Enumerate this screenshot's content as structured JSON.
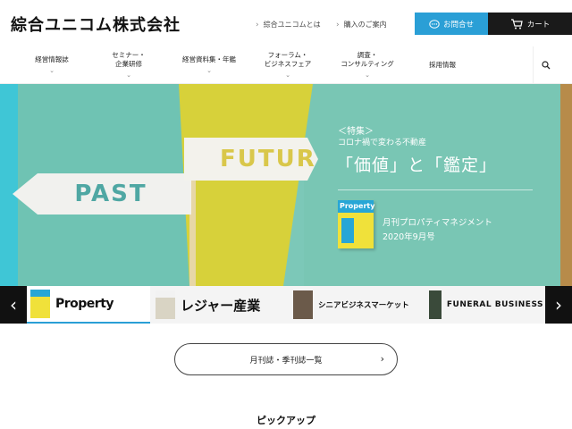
{
  "header": {
    "logo": "綜合ユニコム株式会社",
    "links": [
      {
        "label": "綜合ユニコムとは"
      },
      {
        "label": "購入のご案内"
      }
    ],
    "contact_label": "お問合せ",
    "cart_label": "カート"
  },
  "nav": {
    "items": [
      {
        "line1": "経営情報誌",
        "line2": ""
      },
      {
        "line1": "セミナー・",
        "line2": "企業研修"
      },
      {
        "line1": "経営資料集・年鑑",
        "line2": ""
      },
      {
        "line1": "フォーラム・",
        "line2": "ビジネスフェア"
      },
      {
        "line1": "調査・",
        "line2": "コンサルティング"
      },
      {
        "line1": "採用情報",
        "line2": ""
      }
    ]
  },
  "hero": {
    "past_word": "PAST",
    "future_word": "FUTUR",
    "tag": "＜特集＞",
    "subtitle": "コロナ禍で変わる不動産",
    "title": "「価値」と「鑑定」",
    "magazine_cover_text": "Property",
    "magazine_name": "月刊プロパティマネジメント",
    "issue": "2020年9月号"
  },
  "carousel": {
    "slides": [
      {
        "label": "Property"
      },
      {
        "label": "レジャー産業"
      },
      {
        "label": "シニアビジネスマーケット"
      },
      {
        "label": "FUNERAL BUSINESS"
      }
    ]
  },
  "list_button": {
    "label": "月刊誌・季刊誌一覧"
  },
  "section": {
    "pickup_title": "ピックアップ"
  },
  "colors": {
    "accent": "#2a9fd6",
    "cart": "#1a1a1a",
    "hero_teal": "#79c6b4",
    "hero_yellow": "#d7d13a"
  }
}
